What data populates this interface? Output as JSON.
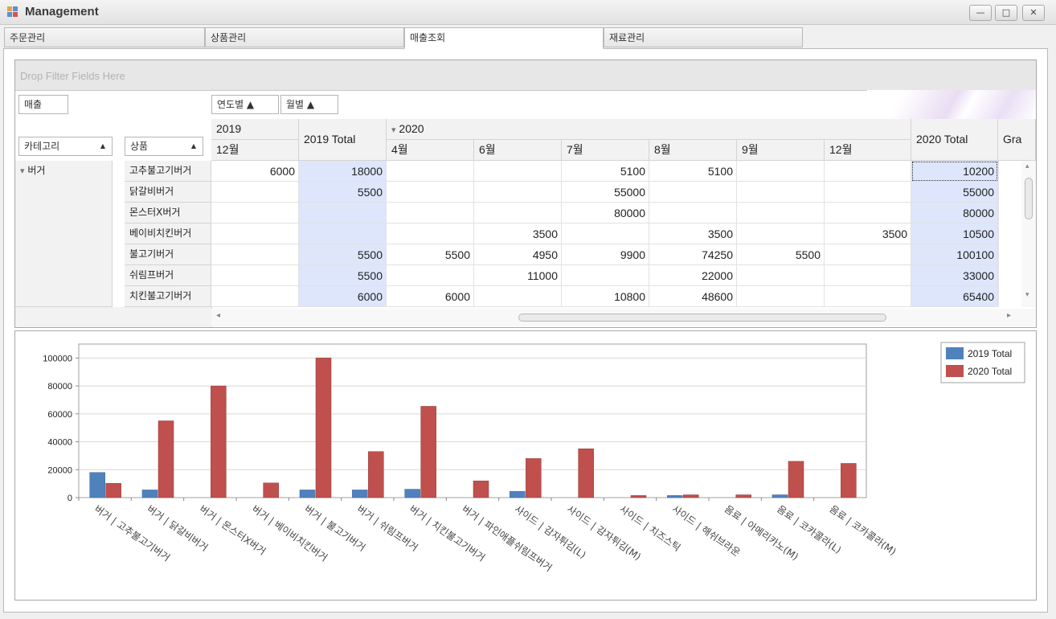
{
  "window": {
    "title": "Management",
    "min": "—",
    "max": "□",
    "close": "✕"
  },
  "tabs": [
    "주문관리",
    "상품관리",
    "매출조회",
    "재료관리"
  ],
  "pivot": {
    "filter_placeholder": "Drop Filter Fields Here",
    "data_field": "매출",
    "col_fields": [
      "연도별 ▲",
      "월별 ▲"
    ],
    "row_fields": [
      "카테고리",
      "상품"
    ],
    "sort_arrow": "▲",
    "expand_glyph": "▾",
    "year2019": "2019",
    "year2019_total": "2019 Total",
    "year2020": "2020",
    "year2020_total": "2020 Total",
    "grand_total_clip": "Gra",
    "months": [
      "12월",
      "4월",
      "6월",
      "7월",
      "8월",
      "9월",
      "12월"
    ],
    "category": "버거",
    "rows": [
      {
        "name": "고추불고기버거",
        "v": [
          "6000",
          "18000",
          "",
          "",
          "5100",
          "5100",
          "",
          "",
          "10200"
        ]
      },
      {
        "name": "닭갈비버거",
        "v": [
          "",
          "5500",
          "",
          "",
          "55000",
          "",
          "",
          "",
          "55000"
        ]
      },
      {
        "name": "몬스터X버거",
        "v": [
          "",
          "",
          "",
          "",
          "80000",
          "",
          "",
          "",
          "80000"
        ]
      },
      {
        "name": "베이비치킨버거",
        "v": [
          "",
          "",
          "",
          "3500",
          "",
          "3500",
          "",
          "3500",
          "10500"
        ]
      },
      {
        "name": "불고기버거",
        "v": [
          "",
          "5500",
          "5500",
          "4950",
          "9900",
          "74250",
          "5500",
          "",
          "100100"
        ]
      },
      {
        "name": "쉬림프버거",
        "v": [
          "",
          "5500",
          "",
          "11000",
          "",
          "22000",
          "",
          "",
          "33000"
        ]
      },
      {
        "name": "치킨불고기버거",
        "v": [
          "",
          "6000",
          "6000",
          "",
          "10800",
          "48600",
          "",
          "",
          "65400"
        ]
      }
    ]
  },
  "chart_data": {
    "type": "bar",
    "categories": [
      "버거 | 고추불고기버거",
      "버거 | 닭갈비버거",
      "버거 | 몬스터X버거",
      "버거 | 베이비치킨버거",
      "버거 | 불고기버거",
      "버거 | 쉬림프버거",
      "버거 | 치킨불고기버거",
      "버거 | 파인애플쉬림프버거",
      "사이드 | 감자튀김(L)",
      "사이드 | 감자튀김(M)",
      "사이드 | 치즈스틱",
      "사이드 | 해쉬브라운",
      "음료 | 아메리카노(M)",
      "음료 | 코카콜라(L)",
      "음료 | 코카콜라(M)"
    ],
    "series": [
      {
        "name": "2019 Total",
        "color": "#4f81bd",
        "values": [
          18000,
          5500,
          0,
          0,
          5500,
          5500,
          6000,
          0,
          4500,
          0,
          0,
          1500,
          0,
          2000,
          0
        ]
      },
      {
        "name": "2020 Total",
        "color": "#c0504d",
        "values": [
          10200,
          55000,
          80000,
          10500,
          100100,
          33000,
          65400,
          12000,
          28000,
          35000,
          1500,
          2000,
          2000,
          26000,
          24500
        ]
      }
    ],
    "ylim": [
      0,
      110000
    ],
    "yticks": [
      "0",
      "20000",
      "40000",
      "60000",
      "80000",
      "100000"
    ],
    "legend": "top-right"
  }
}
